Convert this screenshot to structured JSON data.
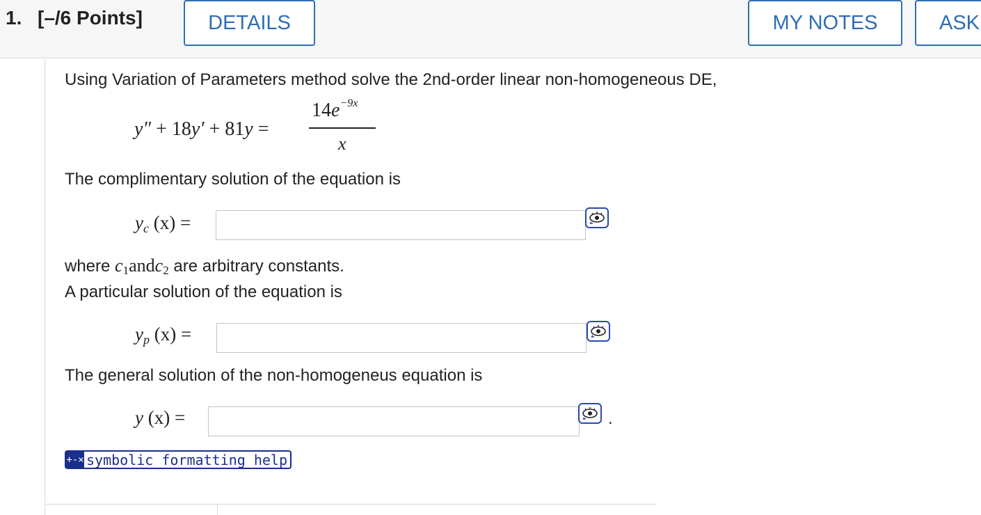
{
  "header": {
    "question_number": "1.",
    "points": "[–/6 Points]",
    "details_label": "DETAILS",
    "my_notes_label": "MY NOTES",
    "ask_label": "ASK"
  },
  "question": {
    "prompt": "Using Variation of Parameters method solve the 2nd-order linear non-homogeneous DE,",
    "equation": {
      "lhs_y2": "y″",
      "lhs_mid": " + 18",
      "lhs_y1": "y′",
      "lhs_tail": " + 81",
      "lhs_y": "y",
      "equals": " =",
      "numerator_coef": "14",
      "numerator_base": "e",
      "numerator_exp": "−9x",
      "denominator": "x"
    },
    "complementary_text": "The complimentary solution of the equation is",
    "yc_label": {
      "var": "y",
      "sub": "c",
      "arg": " (x) ="
    },
    "constants_text_where": "where",
    "constants_c1": "c",
    "constants_c1_sub": "1",
    "constants_and": "and",
    "constants_c2": "c",
    "constants_c2_sub": "2",
    "constants_text_tail": "are arbitrary constants.",
    "particular_text": "A particular solution of the equation is",
    "yp_label": {
      "var": "y",
      "sub": "p",
      "arg": " (x) ="
    },
    "general_text": "The general solution of the non-homogeneus equation is",
    "y_label": {
      "var": "y",
      "arg": " (x) ="
    },
    "period": ".",
    "inputs": {
      "yc_value": "",
      "yp_value": "",
      "y_value": ""
    }
  },
  "help": {
    "icon": "+-×",
    "label": "symbolic formatting help"
  },
  "icons": {
    "preview": "eye-preview-icon"
  },
  "colors": {
    "accent": "#2e6db4",
    "help_blue": "#1a2f8a",
    "header_bg": "#f6f6f6"
  }
}
